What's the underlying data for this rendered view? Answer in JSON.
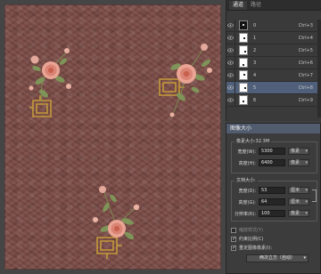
{
  "layers_panel": {
    "tabs": [
      "通道",
      "路径"
    ],
    "layers": [
      {
        "name": "0",
        "shortcut": "Ctrl+3",
        "thumb": "dark",
        "selected": false
      },
      {
        "name": "1",
        "shortcut": "Ctrl+4",
        "thumb": "light",
        "selected": false
      },
      {
        "name": "2",
        "shortcut": "Ctrl+5",
        "thumb": "light",
        "selected": false
      },
      {
        "name": "3",
        "shortcut": "Ctrl+6",
        "thumb": "light",
        "selected": false
      },
      {
        "name": "4",
        "shortcut": "Ctrl+7",
        "thumb": "light",
        "selected": false
      },
      {
        "name": "5",
        "shortcut": "Ctrl+8",
        "thumb": "light",
        "selected": true
      },
      {
        "name": "6",
        "shortcut": "Ctrl+9",
        "thumb": "light",
        "selected": false
      }
    ]
  },
  "dialog": {
    "title": "图像大小",
    "pixel_dimensions": {
      "title": "像素大小:32.3M",
      "width_label": "宽度(W):",
      "width_value": "5300",
      "width_unit": "像素",
      "height_label": "高度(H):",
      "height_value": "6400",
      "height_unit": "像素"
    },
    "document_size": {
      "title": "文档大小:",
      "width_label": "宽度(D):",
      "width_value": "53",
      "width_unit": "厘米",
      "height_label": "高度(G):",
      "height_value": "64",
      "height_unit": "厘米",
      "resolution_label": "分辨率(R):",
      "resolution_value": "100",
      "resolution_unit": "像素"
    },
    "checkboxes": {
      "scale_styles": "缩放样式(Y)",
      "constrain": "约束比例(C)",
      "resample": "重定图像像素(I):"
    },
    "resample_method": "两次立方（自动）"
  }
}
